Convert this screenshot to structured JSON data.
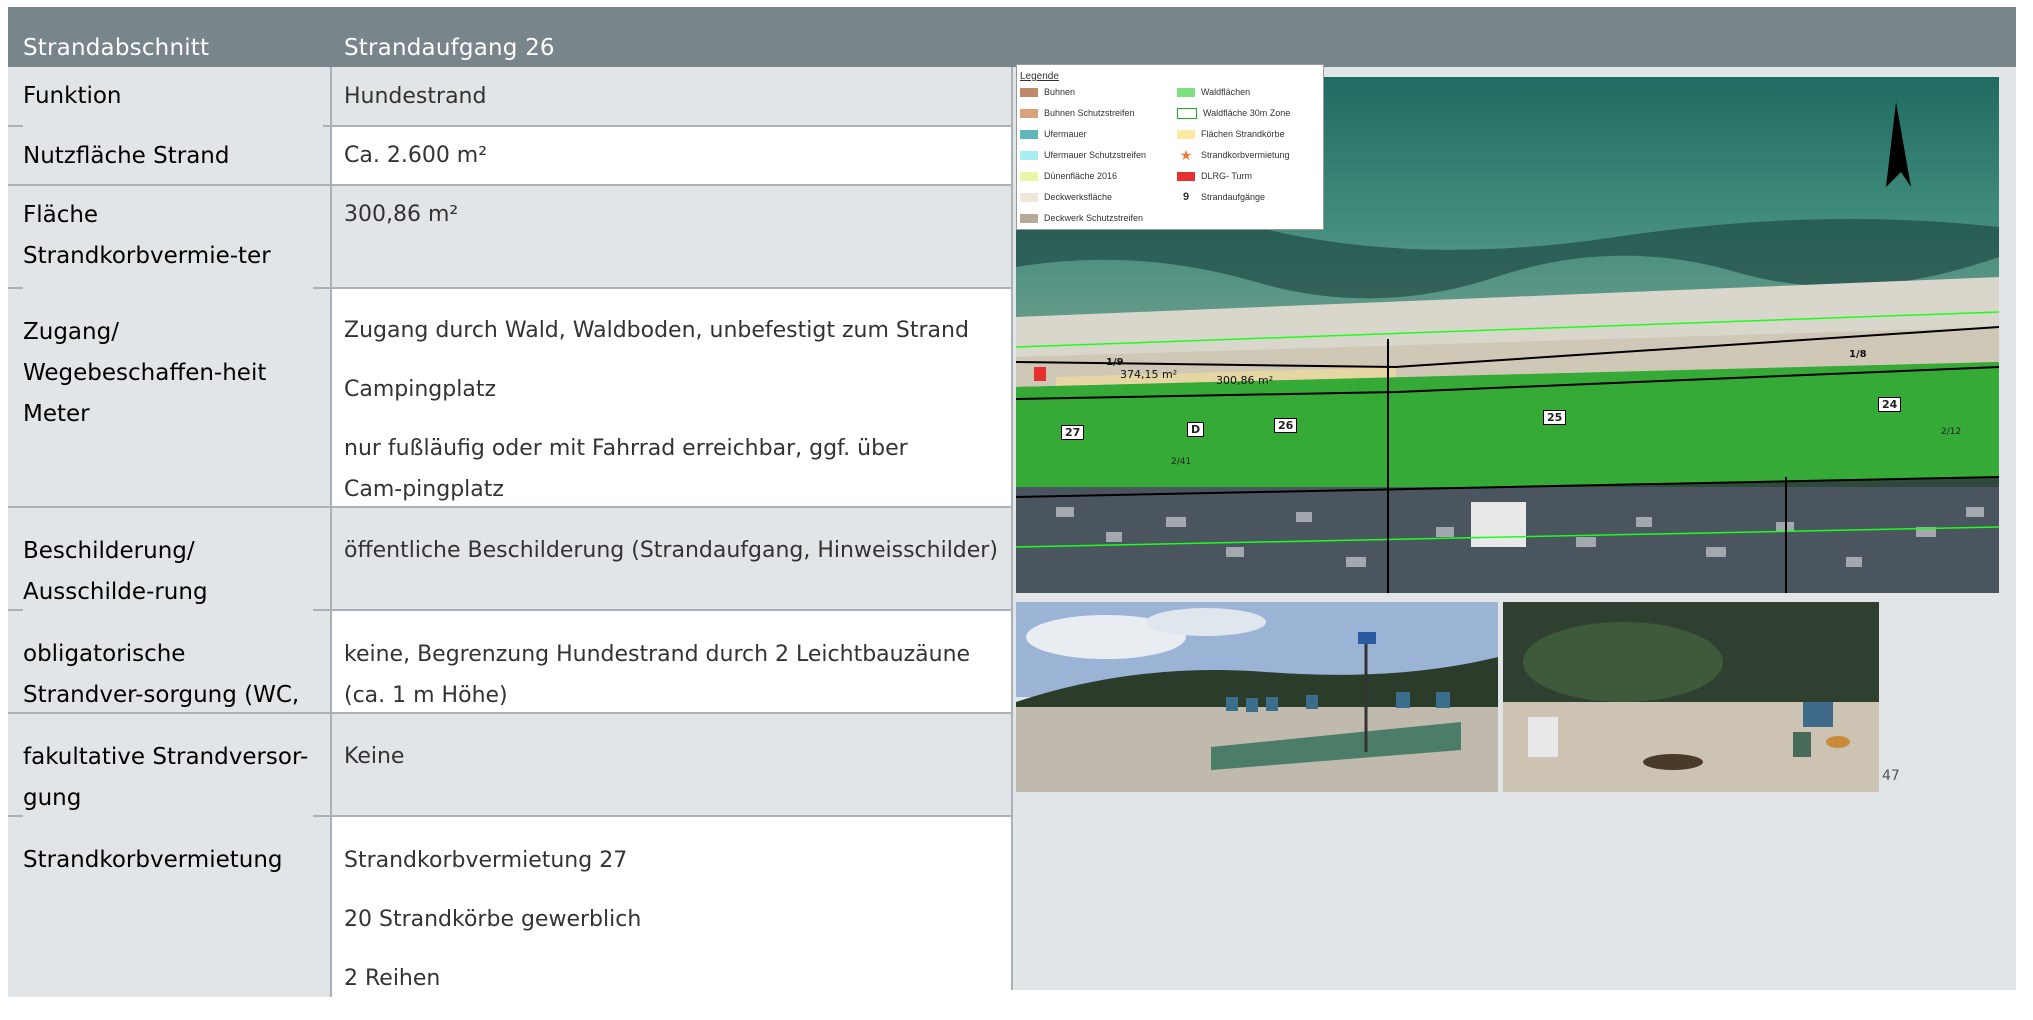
{
  "header": {
    "col1": "Strandabschnitt",
    "col2": "Strandaufgang 26"
  },
  "rows": [
    {
      "label": "Funktion",
      "values": [
        "Hundestrand"
      ]
    },
    {
      "label": "Nutzfläche Strand",
      "values": [
        "Ca. 2.600 m²"
      ]
    },
    {
      "label": "Fläche Strandkorbvermie-ter",
      "values": [
        "300,86 m²"
      ]
    },
    {
      "label": "Zugang/ Wegebeschaffen-heit Meter",
      "values": [
        "Zugang durch Wald, Waldboden, unbefestigt zum Strand",
        "Campingplatz",
        "nur fußläufig oder mit Fahrrad erreichbar, ggf. über Cam-pingplatz"
      ]
    },
    {
      "label": "Beschilderung/ Ausschilde-rung",
      "values": [
        "öffentliche Beschilderung (Strandaufgang, Hinweisschilder)"
      ]
    },
    {
      "label": "obligatorische Strandver-sorgung (WC, Rettung)",
      "values": [
        "keine, Begrenzung Hundestrand durch 2 Leichtbauzäune (ca. 1 m Höhe)"
      ]
    },
    {
      "label": "fakultative Strandversor-gung",
      "values": [
        "Keine"
      ]
    },
    {
      "label": "Strandkorbvermietung",
      "values": [
        "Strandkorbvermietung 27",
        "20 Strandkörbe gewerblich",
        "2 Reihen"
      ]
    }
  ],
  "map": {
    "legend_title": "Legende",
    "legend_left": [
      {
        "label": "Buhnen",
        "color": "#c08a6a"
      },
      {
        "label": "Buhnen Schutzstreifen",
        "color": "#d9a27a"
      },
      {
        "label": "Ufermauer",
        "color": "#5fb7b7"
      },
      {
        "label": "Ufermauer Schutzstreifen",
        "color": "#a8eef0"
      },
      {
        "label": "Dünenfläche 2016",
        "color": "#eaf5a8"
      },
      {
        "label": "Deckwerksfläche",
        "color": "#efe6dc"
      },
      {
        "label": "Deckwerk Schutzstreifen",
        "color": "#b8a898"
      }
    ],
    "legend_right": [
      {
        "label": "Waldflächen",
        "color": "#7fe07f"
      },
      {
        "label": "Waldfläche 30m Zone",
        "color": "#ffffff"
      },
      {
        "label": "Flächen Strandkörbe",
        "color": "#fbe9a4"
      },
      {
        "label": "Strandkorbvermietung",
        "color": "#f07a3a"
      },
      {
        "label": "DLRG- Turm",
        "color": "#e63030"
      },
      {
        "label": "Strandaufgänge",
        "color": "#000000"
      }
    ],
    "legend_number_sample": "9",
    "area_labels": [
      "374,15 m²",
      "300,86 m²"
    ],
    "section_labels": [
      "1/9",
      "1/8",
      "2/41",
      "2/12"
    ],
    "access_numbers": [
      "27",
      "D",
      "26",
      "25",
      "24"
    ]
  },
  "page_number": "47",
  "colors": {
    "header": "#78868b",
    "gray_cell": "#e1e5e7",
    "border": "#a9b3b7"
  }
}
